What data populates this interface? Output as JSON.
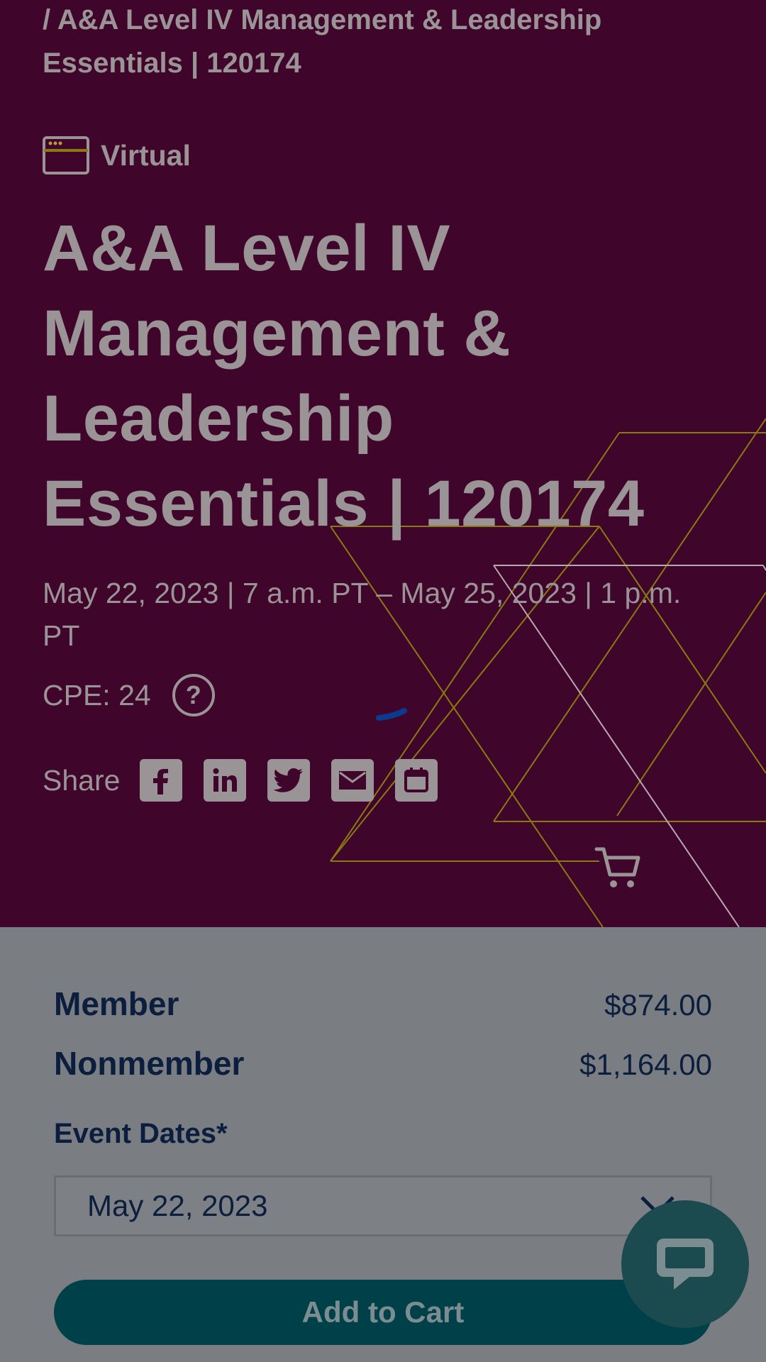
{
  "breadcrumb": "/ A&A Level IV Management & Leadership Essentials | 120174",
  "event": {
    "format_label": "Virtual",
    "title": "A&A Level IV Management & Leadership Essentials | 120174",
    "dates": "May 22, 2023 | 7 a.m. PT – May 25, 2023 | 1 p.m. PT",
    "cpe": "CPE: 24",
    "help_symbol": "?",
    "share_label": "Share",
    "share_icons": [
      "facebook-icon",
      "linkedin-icon",
      "twitter-icon",
      "email-icon",
      "calendar-icon"
    ]
  },
  "pricing": {
    "member_label": "Member",
    "member_price": "$874.00",
    "nonmember_label": "Nonmember",
    "nonmember_price": "$1,164.00"
  },
  "form": {
    "event_dates_label": "Event Dates*",
    "event_dates_selected": "May 22, 2023",
    "add_to_cart_label": "Add to Cart"
  },
  "colors": {
    "hero_background": "#3f052a",
    "overlay_text": "#9b9496",
    "deco_lines": "#8a7a10",
    "button": "#004049",
    "chat_button": "#1b4a4f",
    "dark_text": "#0c1e3d"
  }
}
